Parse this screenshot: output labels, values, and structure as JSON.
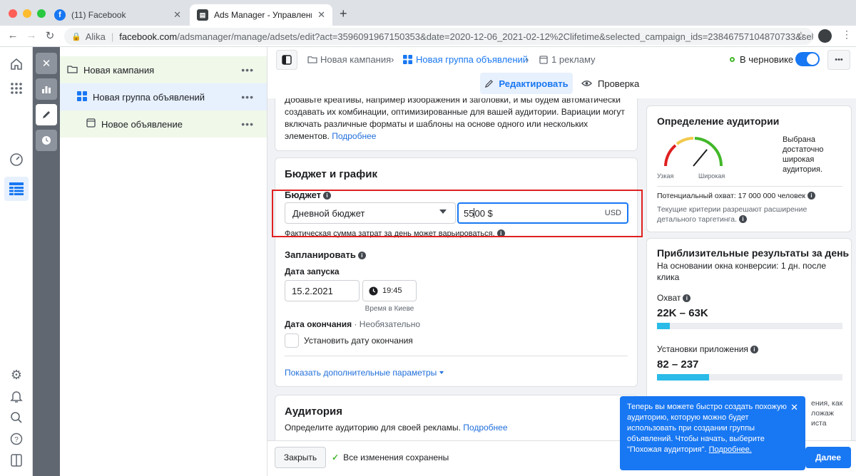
{
  "browser": {
    "tabs": [
      {
        "title": "(11) Facebook"
      },
      {
        "title": "Ads Manager - Управление ре"
      }
    ],
    "url_user": "Alika",
    "url_host": "facebook.com",
    "url_path": "/adsmanager/manage/adsets/edit?act=3596091967150353&date=2020-12-06_2021-02-12%2Clifetime&selected_campaign_ids=23846757104870733&select..."
  },
  "tree": {
    "campaign": "Новая кампания",
    "adset": "Новая группа объявлений",
    "ad": "Новое объявление",
    "more": "•••"
  },
  "topbar": {
    "crumb_campaign": "Новая кампания",
    "crumb_adset": "Новая группа объявлений",
    "crumb_ad": "1 рекламу",
    "status": "В черновике",
    "edit_tab": "Редактировать",
    "review_tab": "Проверка",
    "more": "•••"
  },
  "creative_card": {
    "text": "Добавьте креативы, например изображения и заголовки, и мы будем автоматически создавать их комбинации, оптимизированные для вашей аудитории. Вариации могут включать различные форматы и шаблоны на основе одного или нескольких элементов.",
    "more_link": "Подробнее"
  },
  "budget": {
    "section_title": "Бюджет и график",
    "budget_label": "Бюджет",
    "budget_type": "Дневной бюджет",
    "amount_before": "55",
    "amount_after": "00 $",
    "currency": "USD",
    "note": "Фактическая сумма затрат за день может варьироваться.",
    "schedule_label": "Запланировать",
    "start_label": "Дата запуска",
    "start_date": "15.2.2021",
    "start_time": "19:45",
    "timezone": "Время в Киеве",
    "end_label": "Дата окончания",
    "end_optional": " · Необязательно",
    "end_checkbox": "Установить дату окончания",
    "advanced_link": "Показать дополнительные параметры"
  },
  "audience_card": {
    "title": "Аудитория",
    "desc": "Определите аудиторию для своей рекламы.",
    "more_link": "Подробнее"
  },
  "audience_def": {
    "title": "Определение аудитории",
    "narrow": "Узкая",
    "wide": "Широкая",
    "verdict": "Выбрана достаточно широкая аудитория.",
    "reach": "Потенциальный охват: 17 000 000 человек",
    "criteria": "Текущие критерии разрешают расширение детального таргетинга.",
    "gauge_level": 0.72
  },
  "estimates": {
    "title": "Приблизительные результаты за день",
    "basis": "На основании окна конверсии: 1 дн. после клика",
    "reach_label": "Охват",
    "reach_value": "22K – 63K",
    "reach_fill": 0.07,
    "installs_label": "Установки приложения",
    "installs_value": "82 – 237",
    "installs_fill": 0.28
  },
  "tooltip": {
    "text": "Теперь вы можете быстро создать похожую аудиторию, которую можно будет использовать при создании группы объявлений. Чтобы начать, выберите \"Похожая аудитория\".",
    "link": "Подробнее.",
    "behind_1": "ения, как",
    "behind_2": "ложаж",
    "behind_3": "иста"
  },
  "bottombar": {
    "close": "Закрыть",
    "saved": "Все изменения сохранены",
    "next": "Далее"
  },
  "colors": {
    "accent": "#1877f2",
    "highlight": "#e02020",
    "tooltip_bg": "#1877f2",
    "status_dot": "#42b72a"
  }
}
